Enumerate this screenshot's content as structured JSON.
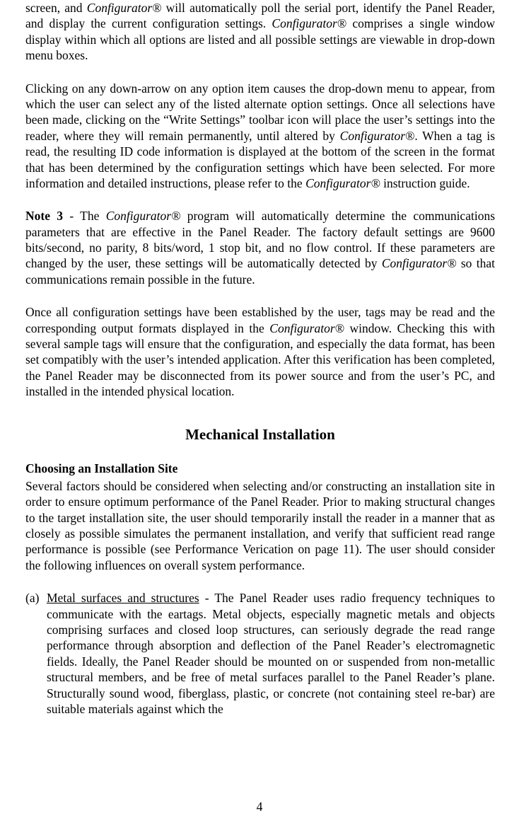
{
  "p1": {
    "a": "screen, and ",
    "b": "Configurator®",
    "c": " will automatically poll the serial port, identify the Panel Reader, and display the current configuration settings.  ",
    "d": "Configurator®",
    "e": " comprises a single window display within which all options are listed and all possible settings are viewable in drop-down menu boxes."
  },
  "p2": {
    "a": "Clicking on any down-arrow on any option item causes the drop-down menu to appear, from which the user can select any of the listed alternate option settings.  Once all selections have been made, clicking on the “Write Settings”  toolbar icon will place the user’s settings into the reader, where they will remain permanently, until altered by ",
    "b": "Configurator®",
    "c": ".  When a tag is read, the resulting ID code information is displayed at the bottom of the screen in the format that has been determined by the configuration settings which have been selected.  For more information and detailed instructions, please refer to the ",
    "d": "Configurator®",
    "e": " instruction guide."
  },
  "p3": {
    "label": "Note 3",
    "a": "  -  The ",
    "b": "Configurator®",
    "c": " program will automatically determine the communications parameters that are effective in the Panel Reader.  The factory default settings are 9600 bits/second, no parity, 8 bits/word, 1 stop bit, and no flow control.  If these parameters are changed by the user, these settings will be automatically detected by ",
    "d": "Configurator®",
    "e": " so that communications remain possible in the future."
  },
  "p4": {
    "a": "Once all configuration settings have been established by the user, tags may be read and the corresponding output formats displayed in the ",
    "b": "Configurator®",
    "c": " window.  Checking this with several sample tags will ensure that the configuration, and especially the data format, has been set compatibly with the user’s intended application.   After this verification has been completed, the Panel Reader may be disconnected from its power source and from the user’s PC, and installed in the intended physical location."
  },
  "heading": "Mechanical Installation",
  "subheading": "Choosing an Installation Site",
  "p5": "Several factors should be considered when selecting and/or constructing an installation site in order to ensure optimum performance of the Panel Reader.  Prior to making structural changes to the target installation site, the user should temporarily install the reader in a manner that as closely as possible simulates the permanent installation, and verify that sufficient read range performance is possible (see Performance Verication on page 11).  The user should consider the following influences on overall system performance.",
  "list": {
    "marker": "(a)",
    "title": "Metal surfaces and structures",
    "body": "  -  The Panel Reader uses radio frequency techniques to communicate with the eartags.  Metal objects, especially magnetic metals and objects comprising surfaces and closed loop structures, can seriously degrade the read range performance through absorption and deflection of the Panel Reader’s electromagnetic fields.   Ideally, the Panel Reader should be mounted on or suspended from non-metallic structural members, and be free of metal surfaces parallel to the Panel Reader’s plane.  Structurally sound wood, fiberglass, plastic, or concrete (not containing steel re-bar) are suitable materials against which the"
  },
  "pagenum": "4"
}
